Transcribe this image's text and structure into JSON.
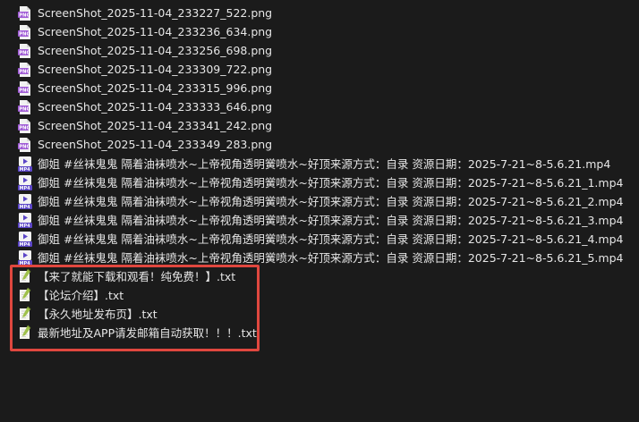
{
  "files": [
    {
      "name": "ScreenShot_2025-11-04_233227_522.png",
      "icon": "png-file-icon"
    },
    {
      "name": "ScreenShot_2025-11-04_233236_634.png",
      "icon": "png-file-icon"
    },
    {
      "name": "ScreenShot_2025-11-04_233256_698.png",
      "icon": "png-file-icon"
    },
    {
      "name": "ScreenShot_2025-11-04_233309_722.png",
      "icon": "png-file-icon"
    },
    {
      "name": "ScreenShot_2025-11-04_233315_996.png",
      "icon": "png-file-icon"
    },
    {
      "name": "ScreenShot_2025-11-04_233333_646.png",
      "icon": "png-file-icon"
    },
    {
      "name": "ScreenShot_2025-11-04_233341_242.png",
      "icon": "png-file-icon"
    },
    {
      "name": "ScreenShot_2025-11-04_233349_283.png",
      "icon": "png-file-icon"
    },
    {
      "name": "御姐 #丝袜鬼鬼 隔着油袜喷水~上帝视角透明黉喷水~好顶来源方式：自录 资源日期：2025-7-21~8-5.6.21.mp4",
      "icon": "mp4-file-icon"
    },
    {
      "name": "御姐 #丝袜鬼鬼 隔着油袜喷水~上帝视角透明黉喷水~好顶来源方式：自录 资源日期：2025-7-21~8-5.6.21_1.mp4",
      "icon": "mp4-file-icon"
    },
    {
      "name": "御姐 #丝袜鬼鬼 隔着油袜喷水~上帝视角透明黉喷水~好顶来源方式：自录 资源日期：2025-7-21~8-5.6.21_2.mp4",
      "icon": "mp4-file-icon"
    },
    {
      "name": "御姐 #丝袜鬼鬼 隔着油袜喷水~上帝视角透明黉喷水~好顶来源方式：自录 资源日期：2025-7-21~8-5.6.21_3.mp4",
      "icon": "mp4-file-icon"
    },
    {
      "name": "御姐 #丝袜鬼鬼 隔着油袜喷水~上帝视角透明黉喷水~好顶来源方式：自录 资源日期：2025-7-21~8-5.6.21_4.mp4",
      "icon": "mp4-file-icon"
    },
    {
      "name": "御姐 #丝袜鬼鬼 隔着油袜喷水~上帝视角透明黉喷水~好顶来源方式：自录 资源日期：2025-7-21~8-5.6.21_5.mp4",
      "icon": "mp4-file-icon"
    },
    {
      "name": "【来了就能下载和观看！纯免费！】.txt",
      "icon": "txt-file-icon"
    },
    {
      "name": "【论坛介绍】.txt",
      "icon": "txt-file-icon"
    },
    {
      "name": "【永久地址发布页】.txt",
      "icon": "txt-file-icon"
    },
    {
      "name": "最新地址及APP请发邮箱自动获取！！！.txt",
      "icon": "txt-file-icon"
    }
  ],
  "colors": {
    "background": "#1b1b1b",
    "text": "#e6e6e6",
    "highlight_border": "#e0473f",
    "png_icon": "#a05bd6",
    "mp4_icon": "#5b45c7",
    "txt_icon": "#9fc14a"
  }
}
